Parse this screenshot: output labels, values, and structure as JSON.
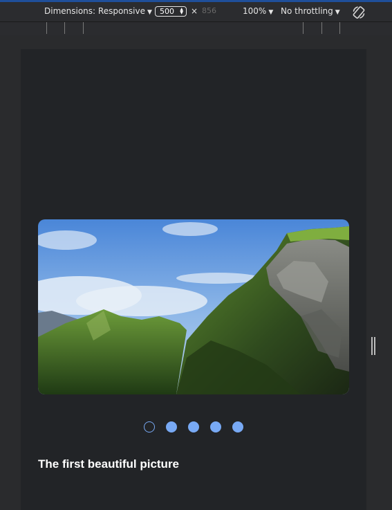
{
  "toolbar": {
    "dimensions_label": "Dimensions: Responsive",
    "width_value": "500",
    "times": "×",
    "height_value": "856",
    "zoom_label": "100%",
    "throttle_label": "No throttling",
    "caret": "▼"
  },
  "icons": {
    "rotate": "rotate-icon",
    "spin": "spin-icon",
    "resize": "resize-handle-icon"
  },
  "colors": {
    "accent": "#78a9f4",
    "device_bg": "#222427",
    "page_bg": "#2a2b2d"
  },
  "carousel": {
    "slides_count_visible": "5",
    "active_index": 0,
    "caption": "The first beautiful picture"
  }
}
